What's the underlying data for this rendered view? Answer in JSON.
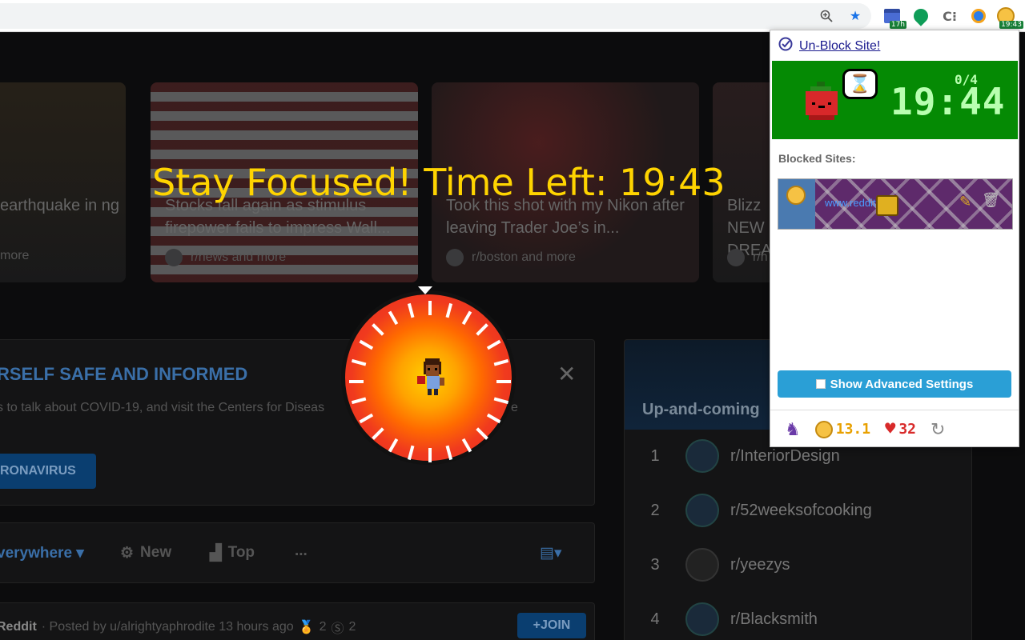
{
  "toolbar": {
    "zoom_icon": "zoom-icon",
    "star_icon": "star-icon",
    "ext1_badge": "17h",
    "ext_clock_badge": "19:43"
  },
  "page": {
    "cards": [
      {
        "title": "earthquake in ng",
        "source": "more"
      },
      {
        "title": "Stocks fall again as stimulus firepower fails to impress Wall...",
        "source": "r/news and more"
      },
      {
        "title": "Took this shot with my Nikon after leaving Trader Joe’s in...",
        "source": "r/boston and more"
      },
      {
        "title": "Blizz NEW C DREA",
        "source": "r/h"
      }
    ],
    "focus_message": "Stay Focused! Time Left: 19:43",
    "covid_banner": {
      "title": "RSELF SAFE AND INFORMED",
      "body": "s to talk about COVID-19, and visit the Centers for Diseas",
      "body_right": "e",
      "button": "RONAVIRUS"
    },
    "sort_bar": {
      "everywhere": "verywhere",
      "new": "New",
      "top": "Top",
      "more": "..."
    },
    "post": {
      "sub": "Reddit",
      "meta": "· Posted by u/alrightyaphrodite 13 hours ago",
      "award1": "2",
      "award2": "2",
      "join": "+JOIN"
    },
    "upcoming": {
      "title": "Up-and-coming",
      "items": [
        {
          "rank": "1",
          "name": "r/InteriorDesign"
        },
        {
          "rank": "2",
          "name": "r/52weeksofcooking"
        },
        {
          "rank": "3",
          "name": "r/yeezys"
        },
        {
          "rank": "4",
          "name": "r/Blacksmith"
        }
      ]
    }
  },
  "popup": {
    "unblock_link": "Un-Block Site!",
    "big_clock": "19:44",
    "counter": "0/4",
    "blocked_label": "Blocked Sites:",
    "blocked_url": "www.reddit.com",
    "advanced_button": "Show Advanced Settings",
    "coins": "13.1",
    "hearts": "32"
  },
  "colors": {
    "focus_text": "#ffd400",
    "timer_green": "#058a04",
    "advanced_blue": "#2a9fd6"
  }
}
